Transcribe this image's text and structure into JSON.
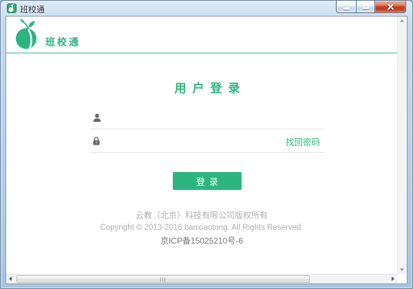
{
  "window": {
    "title": "班校通"
  },
  "header": {
    "logo_text": "班校通"
  },
  "login": {
    "title": "用户登录",
    "username_value": "",
    "username_placeholder": "",
    "password_value": "",
    "password_placeholder": "",
    "forgot_password_label": "找回密码",
    "submit_label": "登录"
  },
  "footer": {
    "line1": "云教（北京）科技有限公司版权所有",
    "line2": "Copyright © 2013-2016 banxiaotong. All Rights Reserved.",
    "line3": "京ICP备15025210号-6"
  },
  "icons": {
    "titlebar": "sprout-app-icon",
    "logo": "sprout-logo-icon",
    "username": "person-icon",
    "password": "lock-icon"
  },
  "colors": {
    "brand_green": "#2cb580",
    "divider_green": "#8fdcc0",
    "titlebar_blue": "#b4cfe9",
    "close_red": "#cc4527"
  }
}
